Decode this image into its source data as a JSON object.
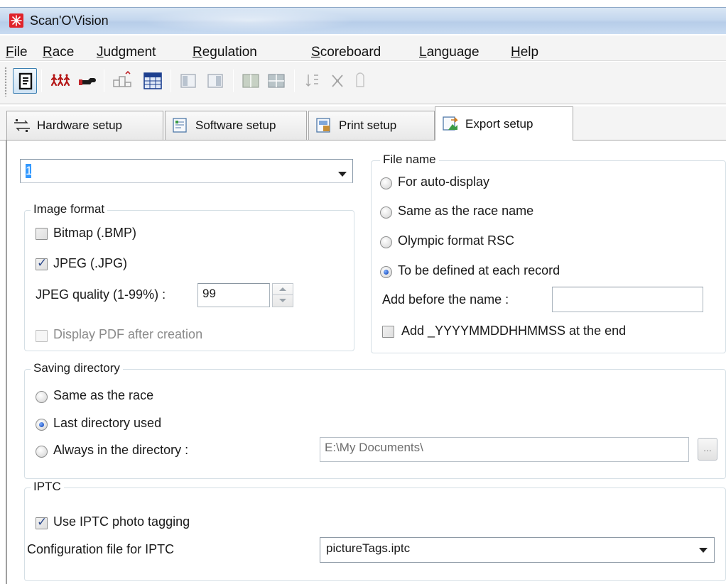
{
  "window": {
    "title": "Scan'O'Vision"
  },
  "menu": [
    {
      "label": "File",
      "mnemonic": "F",
      "rest": "ile"
    },
    {
      "label": "Race",
      "mnemonic": "R",
      "rest": "ace"
    },
    {
      "label": "Judgment",
      "mnemonic": "J",
      "rest": "udgment"
    },
    {
      "label": "Regulation",
      "mnemonic": "R",
      "rest": "egulation"
    },
    {
      "label": "Scoreboard",
      "mnemonic": "S",
      "rest": "coreboard"
    },
    {
      "label": "Language",
      "mnemonic": "L",
      "rest": "anguage"
    },
    {
      "label": "Help",
      "mnemonic": "H",
      "rest": "elp"
    }
  ],
  "tabs": [
    {
      "label": "Hardware setup",
      "icon": "hardware-icon",
      "active": false
    },
    {
      "label": "Software setup",
      "icon": "software-icon",
      "active": false
    },
    {
      "label": "Print setup",
      "icon": "print-icon",
      "active": false
    },
    {
      "label": "Export setup",
      "icon": "export-icon",
      "active": true
    }
  ],
  "export": {
    "profile_select": "1",
    "image_format": {
      "title": "Image format",
      "bitmap": {
        "label": "Bitmap (.BMP)",
        "checked": false
      },
      "jpeg": {
        "label": "JPEG (.JPG)",
        "checked": true
      },
      "quality_label": "JPEG quality (1-99%) :",
      "quality_value": "99",
      "display_pdf": {
        "label": "Display PDF after creation",
        "checked": false,
        "disabled": true
      }
    },
    "file_name": {
      "title": "File name",
      "options": [
        {
          "label": "For auto-display",
          "selected": false
        },
        {
          "label": "Same as the race name",
          "selected": false
        },
        {
          "label": "Olympic format RSC",
          "selected": false
        },
        {
          "label": "To be defined at each record",
          "selected": true
        }
      ],
      "add_before_label": "Add before the name :",
      "add_before_value": "",
      "add_timestamp": {
        "label": "Add _YYYYMMDDHHMMSS at the end",
        "checked": false
      }
    },
    "saving_directory": {
      "title": "Saving directory",
      "options": [
        {
          "label": "Same as the race",
          "selected": false
        },
        {
          "label": "Last directory used",
          "selected": true
        },
        {
          "label": "Always in the directory :",
          "selected": false
        }
      ],
      "path": "E:\\My Documents\\",
      "browse_label": "..."
    },
    "iptc": {
      "title": "IPTC",
      "use": {
        "label": "Use IPTC photo tagging",
        "checked": true
      },
      "config_label": "Configuration file for IPTC",
      "config_value": "pictureTags.iptc"
    }
  },
  "colors": {
    "accent": "#3399ff",
    "titlebar": "#c4d7ee",
    "radio_dot": "#1c4fbf",
    "check": "#2d4a8c"
  }
}
